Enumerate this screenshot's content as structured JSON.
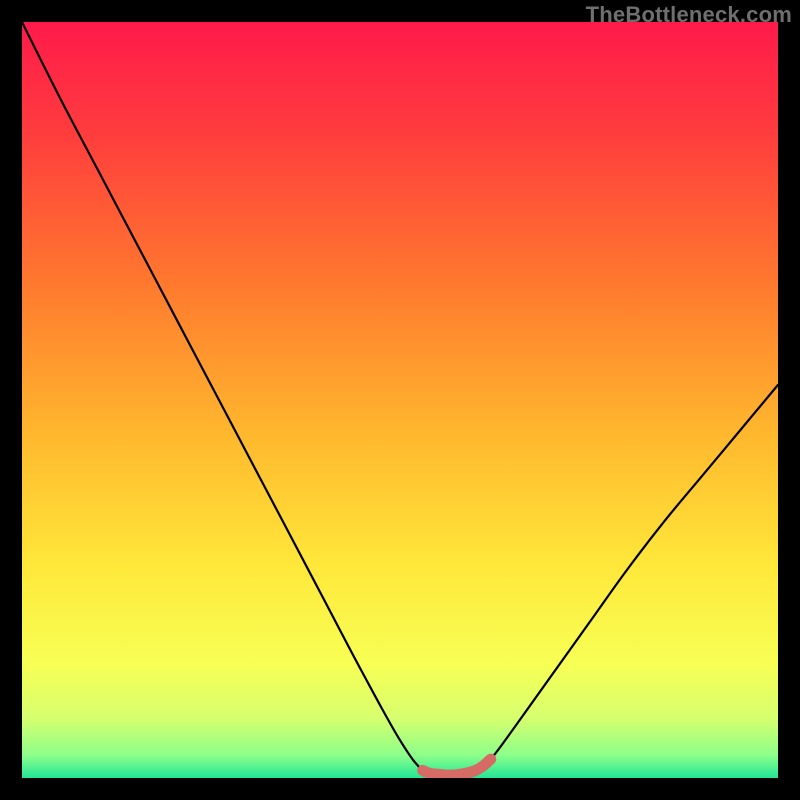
{
  "watermark": "TheBottleneck.com",
  "chart_data": {
    "type": "line",
    "title": "",
    "xlabel": "",
    "ylabel": "",
    "xlim": [
      0,
      100
    ],
    "ylim": [
      0,
      100
    ],
    "grid": false,
    "series": [
      {
        "name": "bottleneck-curve",
        "x": [
          0,
          5,
          10,
          15,
          20,
          25,
          30,
          35,
          40,
          45,
          50,
          53,
          55,
          58,
          60,
          62,
          65,
          70,
          75,
          80,
          85,
          90,
          95,
          100
        ],
        "values": [
          100,
          90,
          80.5,
          71,
          61.5,
          52,
          42.5,
          33,
          23.5,
          14,
          5,
          1,
          0.5,
          0.5,
          1,
          2.5,
          6.5,
          13.5,
          20.5,
          27.5,
          34,
          40,
          46,
          52
        ]
      },
      {
        "name": "optimal-zone",
        "x": [
          53,
          54,
          55,
          56,
          57,
          58,
          59,
          60,
          61,
          62
        ],
        "values": [
          1.0,
          0.6,
          0.5,
          0.4,
          0.4,
          0.5,
          0.7,
          1.0,
          1.6,
          2.5
        ]
      }
    ],
    "background_gradient": {
      "stops": [
        {
          "offset": 0.0,
          "color": "#ff1a4b"
        },
        {
          "offset": 0.15,
          "color": "#ff3d3d"
        },
        {
          "offset": 0.35,
          "color": "#ff7a2e"
        },
        {
          "offset": 0.55,
          "color": "#ffb92e"
        },
        {
          "offset": 0.72,
          "color": "#ffe83a"
        },
        {
          "offset": 0.85,
          "color": "#f7ff55"
        },
        {
          "offset": 0.92,
          "color": "#d7ff6e"
        },
        {
          "offset": 0.97,
          "color": "#8dff8a"
        },
        {
          "offset": 1.0,
          "color": "#22e596"
        }
      ]
    },
    "colors": {
      "curve": "#000000",
      "optimal_zone": "#d66a64"
    }
  }
}
